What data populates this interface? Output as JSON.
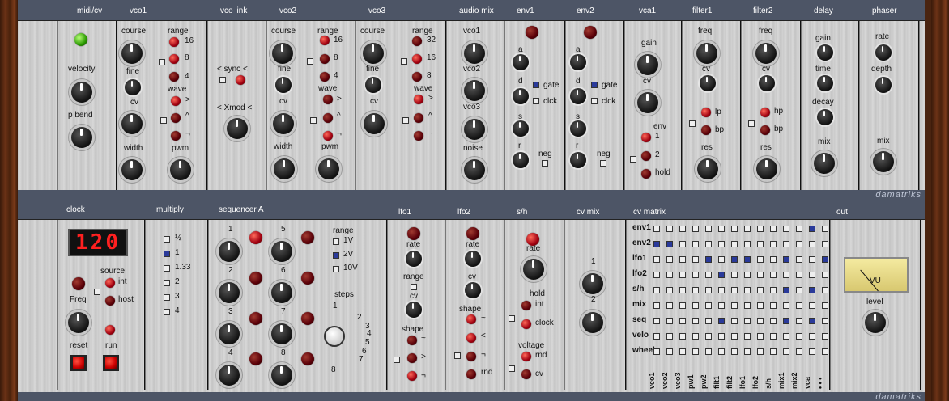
{
  "brand": "damatriks",
  "top_titles": [
    "midi/cv",
    "vco1",
    "vco link",
    "vco2",
    "vco3",
    "audio mix",
    "env1",
    "env2",
    "vca1",
    "filter1",
    "filter2",
    "delay",
    "phaser"
  ],
  "bottom_titles": [
    "clock",
    "multiply",
    "sequencer A",
    "lfo1",
    "lfo2",
    "s/h",
    "cv mix",
    "cv matrix",
    "out"
  ],
  "midi": {
    "velocity": "velocity",
    "pbend": "p bend"
  },
  "vco1": {
    "course": "course",
    "fine": "fine",
    "cv": "cv",
    "width": "width",
    "range": "range",
    "r1": "16",
    "r2": "8",
    "r3": "4",
    "wave": "wave",
    "pwm": "pwm",
    "w1": ">",
    "w2": "^",
    "w3": "¬"
  },
  "vlink": {
    "sync": "< sync <",
    "xmod": "< Xmod <"
  },
  "vco2": {
    "course": "course",
    "fine": "fine",
    "cv": "cv",
    "width": "width",
    "range": "range",
    "r1": "16",
    "r2": "8",
    "r3": "4",
    "wave": "wave",
    "pwm": "pwm",
    "w1": ">",
    "w2": "^",
    "w3": "¬"
  },
  "vco3": {
    "course": "course",
    "fine": "fine",
    "cv": "cv",
    "range": "range",
    "r1": "32",
    "r2": "16",
    "r3": "8",
    "wave": "wave",
    "w1": ">",
    "w2": "^",
    "w3": "~"
  },
  "amix": {
    "a": "vco1",
    "b": "vco2",
    "c": "vco3",
    "d": "noise"
  },
  "env1": {
    "a": "a",
    "d": "d",
    "s": "s",
    "r": "r",
    "gate": "gate",
    "clck": "clck",
    "neg": "neg"
  },
  "env2": {
    "a": "a",
    "d": "d",
    "s": "s",
    "r": "r",
    "gate": "gate",
    "clck": "clck",
    "neg": "neg"
  },
  "vca": {
    "gain": "gain",
    "cv": "cv",
    "env": "env",
    "e1": "1",
    "e2": "2",
    "hold": "hold"
  },
  "f1": {
    "freq": "freq",
    "cv": "cv",
    "lp": "lp",
    "bp": "bp",
    "res": "res"
  },
  "f2": {
    "freq": "freq",
    "cv": "cv",
    "hp": "hp",
    "bp": "bp",
    "res": "res"
  },
  "delay": {
    "gain": "gain",
    "time": "time",
    "decay": "decay",
    "mix": "mix"
  },
  "phaser": {
    "rate": "rate",
    "depth": "depth",
    "mix": "mix"
  },
  "clock": {
    "display": "120",
    "source": "source",
    "int": "int",
    "host": "host",
    "freq": "Freq",
    "reset": "reset",
    "run": "run"
  },
  "multiply": [
    "½",
    "1",
    "1.33",
    "2",
    "3",
    "4"
  ],
  "seq": {
    "n": [
      "1",
      "2",
      "3",
      "4",
      "5",
      "6",
      "7",
      "8"
    ],
    "range": "range",
    "r": [
      "1V",
      "2V",
      "10V"
    ],
    "steps": "steps",
    "s": [
      "1",
      "2",
      "3",
      "4",
      "5",
      "6",
      "7",
      "8"
    ]
  },
  "lfo1": {
    "rate": "rate",
    "range": "range",
    "cv": "cv",
    "shape": "shape",
    "s1": "~",
    "s2": ">",
    "s3": "¬"
  },
  "lfo2": {
    "rate": "rate",
    "cv": "cv",
    "shape": "shape",
    "s1": "~",
    "s2": "<",
    "s3": "¬",
    "s4": "rnd"
  },
  "sh": {
    "rate": "rate",
    "hold": "hold",
    "int": "int",
    "clock": "clock",
    "voltage": "voltage",
    "rnd": "rnd",
    "cv": "cv"
  },
  "cvmix": {
    "a": "1",
    "b": "2"
  },
  "matrix": {
    "rows": [
      "env1",
      "env2",
      "lfo1",
      "lfo2",
      "s/h",
      "mix",
      "seq",
      "velo",
      "wheel"
    ],
    "cols": [
      "vco1",
      "vco2",
      "vco3",
      "pw1",
      "pw2",
      "filt1",
      "filt2",
      "lfo1",
      "lfo2",
      "s/h",
      "mix1",
      "mix2",
      "vca",
      "• • •"
    ],
    "on": [
      [
        0,
        12
      ],
      [
        1,
        0
      ],
      [
        1,
        1
      ],
      [
        2,
        4
      ],
      [
        2,
        6
      ],
      [
        2,
        7
      ],
      [
        2,
        10
      ],
      [
        2,
        13
      ],
      [
        3,
        5
      ],
      [
        4,
        10
      ],
      [
        4,
        12
      ],
      [
        6,
        5
      ],
      [
        6,
        10
      ],
      [
        6,
        12
      ]
    ]
  },
  "out": {
    "vu": "VU",
    "level": "level"
  }
}
